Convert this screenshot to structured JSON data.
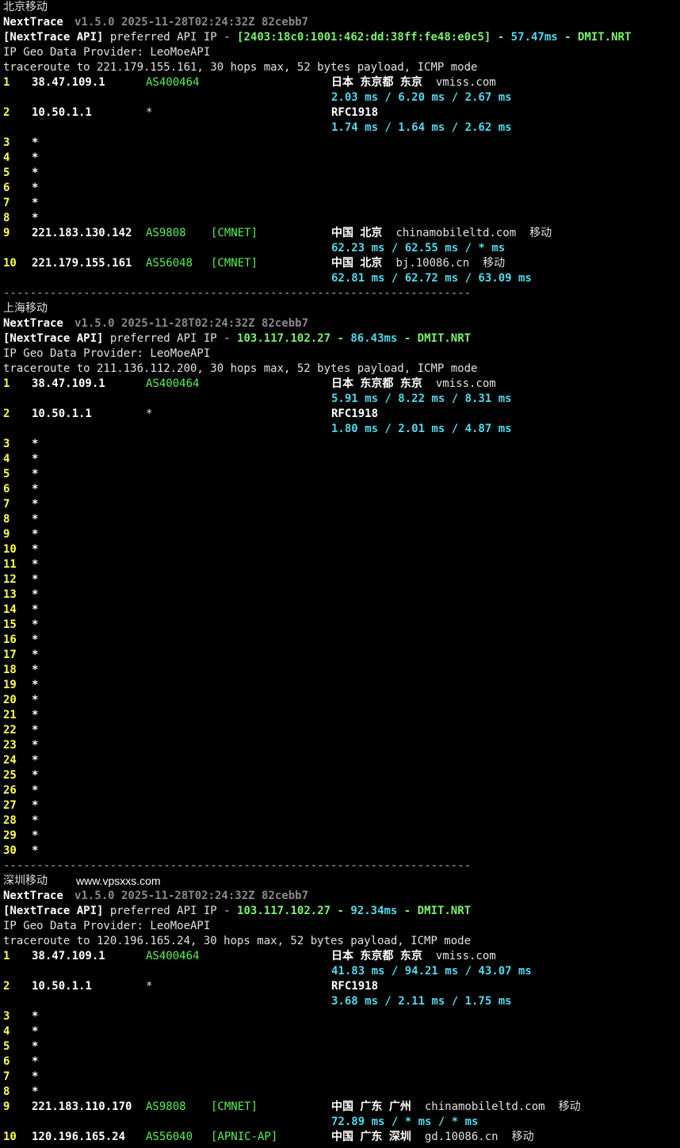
{
  "sections": [
    {
      "title": "北京移动",
      "header": {
        "app": "NextTrace",
        "version": "v1.5.0 2025-11-28T02:24:32Z 82cebb7",
        "api_tag": "[NextTrace API]",
        "api_text": "preferred API IP -",
        "api_ip": "[2403:18c0:1001:462:dd:38ff:fe48:e0c5]",
        "dash1": "-",
        "latency": "57.47ms",
        "dash2": "-",
        "node": "DMIT.NRT",
        "geo_provider": "IP Geo Data Provider: LeoMoeAPI",
        "traceroute": "traceroute to 221.179.155.161, 30 hops max, 52 bytes payload, ICMP mode"
      },
      "hops": [
        {
          "hop": "1",
          "ip": "38.47.109.1",
          "asn": "AS400464",
          "tag": "",
          "geo": "日本 东京都 东京",
          "host": "vmiss.com",
          "isp": "",
          "times": "2.03 ms / 6.20 ms / 2.67 ms"
        },
        {
          "hop": "2",
          "ip": "10.50.1.1",
          "asn": "*",
          "tag": "",
          "geo": "RFC1918",
          "host": "",
          "isp": "",
          "times": "1.74 ms / 1.64 ms / 2.62 ms"
        },
        {
          "hop": "3",
          "ip": "*"
        },
        {
          "hop": "4",
          "ip": "*"
        },
        {
          "hop": "5",
          "ip": "*"
        },
        {
          "hop": "6",
          "ip": "*"
        },
        {
          "hop": "7",
          "ip": "*"
        },
        {
          "hop": "8",
          "ip": "*"
        },
        {
          "hop": "9",
          "ip": "221.183.130.142",
          "asn": "AS9808",
          "tag": "[CMNET]",
          "geo": "中国 北京",
          "host": "chinamobileltd.com",
          "isp": "移动",
          "times": "62.23 ms / 62.55 ms / * ms"
        },
        {
          "hop": "10",
          "ip": "221.179.155.161",
          "asn": "AS56048",
          "tag": "[CMNET]",
          "geo": "中国 北京",
          "host": "bj.10086.cn",
          "isp": "移动",
          "times": "62.81 ms / 62.72 ms / 63.09 ms"
        }
      ]
    },
    {
      "title": "上海移动",
      "header": {
        "app": "NextTrace",
        "version": "v1.5.0 2025-11-28T02:24:32Z 82cebb7",
        "api_tag": "[NextTrace API]",
        "api_text": "preferred API IP -",
        "api_ip": "103.117.102.27",
        "dash1": "-",
        "latency": "86.43ms",
        "dash2": "-",
        "node": "DMIT.NRT",
        "geo_provider": "IP Geo Data Provider: LeoMoeAPI",
        "traceroute": "traceroute to 211.136.112.200, 30 hops max, 52 bytes payload, ICMP mode"
      },
      "hops": [
        {
          "hop": "1",
          "ip": "38.47.109.1",
          "asn": "AS400464",
          "tag": "",
          "geo": "日本 东京都 东京",
          "host": "vmiss.com",
          "isp": "",
          "times": "5.91 ms / 8.22 ms / 8.31 ms"
        },
        {
          "hop": "2",
          "ip": "10.50.1.1",
          "asn": "*",
          "tag": "",
          "geo": "RFC1918",
          "host": "",
          "isp": "",
          "times": "1.80 ms / 2.01 ms / 4.87 ms"
        },
        {
          "hop": "3",
          "ip": "*"
        },
        {
          "hop": "4",
          "ip": "*"
        },
        {
          "hop": "5",
          "ip": "*"
        },
        {
          "hop": "6",
          "ip": "*"
        },
        {
          "hop": "7",
          "ip": "*"
        },
        {
          "hop": "8",
          "ip": "*"
        },
        {
          "hop": "9",
          "ip": "*"
        },
        {
          "hop": "10",
          "ip": "*"
        },
        {
          "hop": "11",
          "ip": "*"
        },
        {
          "hop": "12",
          "ip": "*"
        },
        {
          "hop": "13",
          "ip": "*"
        },
        {
          "hop": "14",
          "ip": "*"
        },
        {
          "hop": "15",
          "ip": "*"
        },
        {
          "hop": "16",
          "ip": "*"
        },
        {
          "hop": "17",
          "ip": "*"
        },
        {
          "hop": "18",
          "ip": "*"
        },
        {
          "hop": "19",
          "ip": "*"
        },
        {
          "hop": "20",
          "ip": "*"
        },
        {
          "hop": "21",
          "ip": "*"
        },
        {
          "hop": "22",
          "ip": "*"
        },
        {
          "hop": "23",
          "ip": "*"
        },
        {
          "hop": "24",
          "ip": "*"
        },
        {
          "hop": "25",
          "ip": "*"
        },
        {
          "hop": "26",
          "ip": "*"
        },
        {
          "hop": "27",
          "ip": "*"
        },
        {
          "hop": "28",
          "ip": "*"
        },
        {
          "hop": "29",
          "ip": "*"
        },
        {
          "hop": "30",
          "ip": "*"
        }
      ]
    },
    {
      "title": "深圳移动",
      "watermark": "www.vpsxxs.com",
      "header": {
        "app": "NextTrace",
        "version": "v1.5.0 2025-11-28T02:24:32Z 82cebb7",
        "api_tag": "[NextTrace API]",
        "api_text": "preferred API IP -",
        "api_ip": "103.117.102.27",
        "dash1": "-",
        "latency": "92.34ms",
        "dash2": "-",
        "node": "DMIT.NRT",
        "geo_provider": "IP Geo Data Provider: LeoMoeAPI",
        "traceroute": "traceroute to 120.196.165.24, 30 hops max, 52 bytes payload, ICMP mode"
      },
      "hops": [
        {
          "hop": "1",
          "ip": "38.47.109.1",
          "asn": "AS400464",
          "tag": "",
          "geo": "日本 东京都 东京",
          "host": "vmiss.com",
          "isp": "",
          "times": "41.83 ms / 94.21 ms / 43.07 ms"
        },
        {
          "hop": "2",
          "ip": "10.50.1.1",
          "asn": "*",
          "tag": "",
          "geo": "RFC1918",
          "host": "",
          "isp": "",
          "times": "3.68 ms / 2.11 ms / 1.75 ms"
        },
        {
          "hop": "3",
          "ip": "*"
        },
        {
          "hop": "4",
          "ip": "*"
        },
        {
          "hop": "5",
          "ip": "*"
        },
        {
          "hop": "6",
          "ip": "*"
        },
        {
          "hop": "7",
          "ip": "*"
        },
        {
          "hop": "8",
          "ip": "*"
        },
        {
          "hop": "9",
          "ip": "221.183.110.170",
          "asn": "AS9808",
          "tag": "[CMNET]",
          "geo": "中国 广东 广州",
          "host": "chinamobileltd.com",
          "isp": "移动",
          "times": "72.89 ms / * ms / * ms"
        },
        {
          "hop": "10",
          "ip": "120.196.165.24",
          "asn": "AS56040",
          "tag": "[APNIC-AP]",
          "geo": "中国 广东 深圳",
          "host": "gd.10086.cn",
          "isp": "移动",
          "times": ""
        }
      ]
    }
  ],
  "separator": "----------------------------------------------------------------------"
}
